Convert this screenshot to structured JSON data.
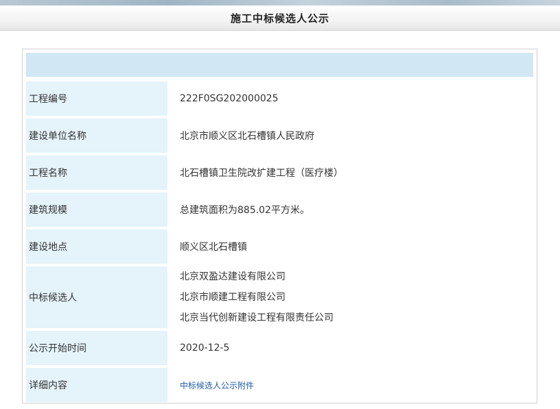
{
  "header": {
    "title": "施工中标候选人公示"
  },
  "rows": [
    {
      "label": "工程编号",
      "value": "222F0SG202000025"
    },
    {
      "label": "建设单位名称",
      "value": "北京市顺义区北石槽镇人民政府"
    },
    {
      "label": "工程名称",
      "value": "北石槽镇卫生院改扩建工程（医疗楼）"
    },
    {
      "label": "建筑规模",
      "value": "总建筑面积为885.02平方米。"
    },
    {
      "label": "建设地点",
      "value": "顺义区北石槽镇"
    }
  ],
  "candidates": {
    "label": "中标候选人",
    "items": [
      "北京双盈达建设有限公司",
      "北京市顺建工程有限公司",
      "北京当代创新建设工程有限责任公司"
    ]
  },
  "publish": {
    "label": "公示开始时间",
    "value": "2020-12-5"
  },
  "details": {
    "label": "详细内容",
    "link_text": "中标候选人公示附件"
  }
}
